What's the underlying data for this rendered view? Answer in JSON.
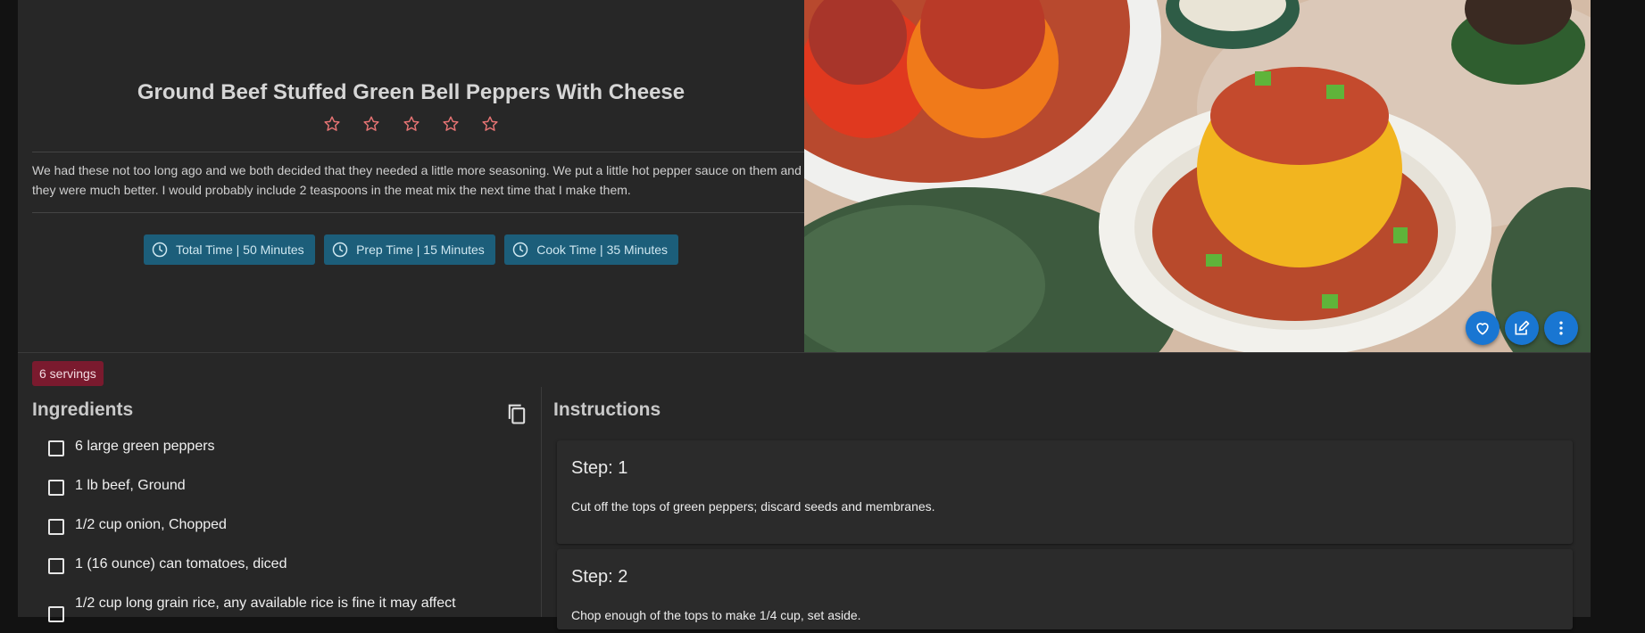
{
  "recipe": {
    "title": "Ground Beef Stuffed Green Bell Peppers With Cheese",
    "rating_max": 5,
    "rating_value": 0,
    "description": "We had these not too long ago and we both decided that they needed a little more seasoning. We put a little hot pepper sauce on them and they were much better. I would probably include 2 teaspoons in the meat mix the next time that I make them.",
    "times": {
      "total": "Total Time | 50 Minutes",
      "prep": "Prep Time | 15 Minutes",
      "cook": "Cook Time | 35 Minutes"
    },
    "servings": "6 servings"
  },
  "ingredients": {
    "heading": "Ingredients",
    "items": [
      "6 large green peppers",
      "1 lb beef, Ground",
      "1/2 cup onion, Chopped",
      "1 (16 ounce) can tomatoes, diced",
      "1/2 cup long grain rice, any available rice is fine it may affect"
    ]
  },
  "instructions": {
    "heading": "Instructions",
    "steps": [
      {
        "title": "Step: 1",
        "text": "Cut off the tops of green peppers; discard seeds and membranes."
      },
      {
        "title": "Step: 2",
        "text": "Chop enough of the tops to make 1/4 cup, set aside."
      }
    ]
  },
  "colors": {
    "star": "#e57373",
    "chip_bg": "#1c5e7a",
    "servings_bg": "#7a1a2e",
    "fab_bg": "#1976d2"
  },
  "icons": {
    "star": "star-outline-icon",
    "clock": "clock-icon",
    "heart": "heart-icon",
    "edit": "edit-icon",
    "more": "more-vertical-icon",
    "copy": "copy-icon"
  }
}
